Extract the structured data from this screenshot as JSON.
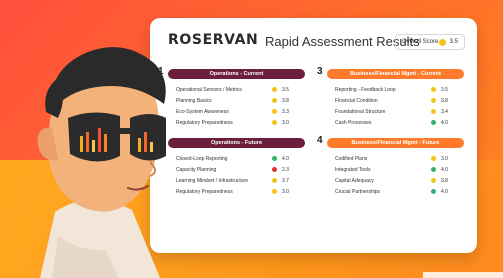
{
  "header": {
    "logo_text": "ROSERVAN",
    "title": "Rapid Assessment Results",
    "overall_label": "Overall Score",
    "overall_value": "3.5"
  },
  "sections": [
    {
      "number": "1",
      "title": "Operations - Current",
      "bar_color": "#6b1f3d",
      "rows": [
        {
          "label": "Operational Sensors / Metrics",
          "value": "3.5",
          "status": "yellow"
        },
        {
          "label": "Planning Basics",
          "value": "3.8",
          "status": "yellow"
        },
        {
          "label": "Eco-System Awareness",
          "value": "3.3",
          "status": "yellow"
        },
        {
          "label": "Regulatory Preparedness",
          "value": "3.0",
          "status": "yellow"
        }
      ]
    },
    {
      "number": "3",
      "title": "Business/Financial Mgmt - Current",
      "bar_color": "#ff7a2a",
      "rows": [
        {
          "label": "Reporting - Feedback Loop",
          "value": "3.5",
          "status": "yellow"
        },
        {
          "label": "Financial Condition",
          "value": "3.8",
          "status": "yellow"
        },
        {
          "label": "Foundational Structure",
          "value": "3.4",
          "status": "yellow"
        },
        {
          "label": "Cash Processes",
          "value": "4.0",
          "status": "green"
        }
      ]
    },
    {
      "number": "",
      "title": "Operations - Future",
      "bar_color": "#6b1f3d",
      "rows": [
        {
          "label": "Closed-Loop Reporting",
          "value": "4.0",
          "status": "green"
        },
        {
          "label": "Capacity Planning",
          "value": "2.3",
          "status": "red"
        },
        {
          "label": "Learning Mindset / Infrastructure",
          "value": "3.7",
          "status": "yellow"
        },
        {
          "label": "Regulatory Preparedness",
          "value": "3.0",
          "status": "yellow"
        }
      ]
    },
    {
      "number": "4",
      "title": "Business/Financial Mgmt - Future",
      "bar_color": "#ff7a2a",
      "rows": [
        {
          "label": "Codified Plans",
          "value": "3.0",
          "status": "yellow"
        },
        {
          "label": "Integrated Tools",
          "value": "4.0",
          "status": "green"
        },
        {
          "label": "Capital Adequacy",
          "value": "3.8",
          "status": "yellow"
        },
        {
          "label": "Crucial Partnerships",
          "value": "4.0",
          "status": "green"
        }
      ]
    }
  ],
  "colors": {
    "yellow": "#f6c31a",
    "green": "#2fb36c",
    "red": "#e0312d"
  }
}
